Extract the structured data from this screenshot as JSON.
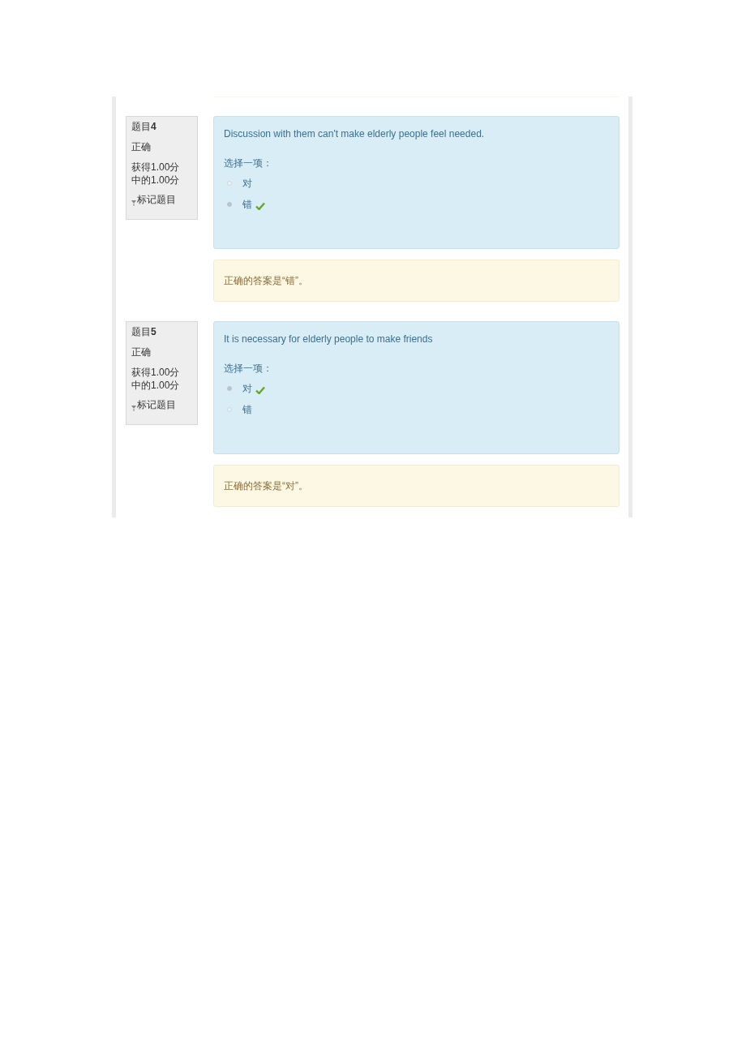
{
  "questions": [
    {
      "number": "题目**4**",
      "status": "正确",
      "score": "获得1.00分",
      "max_score": "中的1.00分",
      "flag": "标记题目",
      "text": "Discussion with them can't make elderly people feel needed.",
      "prompt": "选择一项：",
      "options": [
        {
          "label": "对",
          "selected": false,
          "correct": false
        },
        {
          "label": "错",
          "selected": true,
          "correct": true
        }
      ],
      "feedback": "正确的答案是“错”。"
    },
    {
      "number": "题目**5**",
      "status": "正确",
      "score": "获得1.00分",
      "max_score": "中的1.00分",
      "flag": "标记题目",
      "text": "It is necessary for elderly people to make friends",
      "prompt": "选择一项：",
      "options": [
        {
          "label": "对",
          "selected": true,
          "correct": true
        },
        {
          "label": "错",
          "selected": false,
          "correct": false
        }
      ],
      "feedback": "正确的答案是“对”。"
    }
  ]
}
